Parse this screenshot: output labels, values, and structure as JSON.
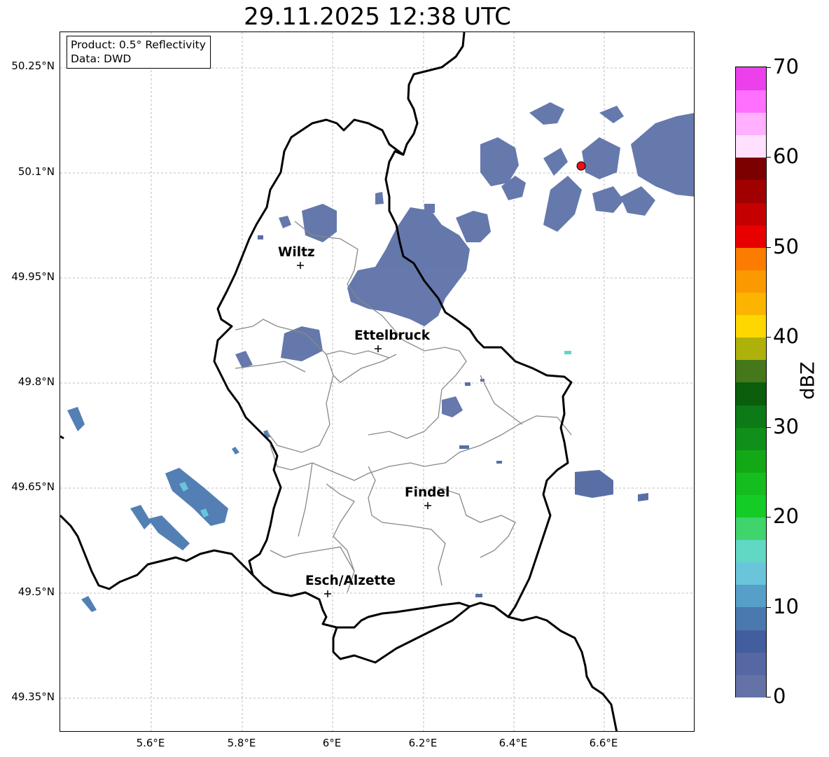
{
  "title": "29.11.2025 12:38 UTC",
  "info": {
    "product": "Product: 0.5° Reflectivity",
    "data_source": "Data: DWD"
  },
  "lat_ticks": [
    "50.25°N",
    "50.1°N",
    "49.95°N",
    "49.8°N",
    "49.65°N",
    "49.5°N",
    "49.35°N"
  ],
  "lon_ticks": [
    "5.6°E",
    "5.8°E",
    "6°E",
    "6.2°E",
    "6.4°E",
    "6.6°E"
  ],
  "cities": [
    {
      "name": "Wiltz"
    },
    {
      "name": "Ettelbruck"
    },
    {
      "name": "Findel"
    },
    {
      "name": "Esch/Alzette"
    }
  ],
  "radar_site_color": "#e8121b",
  "colorbar": {
    "label": "dBZ",
    "ticks": [
      "0",
      "10",
      "20",
      "30",
      "40",
      "50",
      "60",
      "70"
    ],
    "colors": [
      "#6572a8",
      "#5568a3",
      "#435e9f",
      "#4a79b0",
      "#569fc8",
      "#6ac5db",
      "#60d8c4",
      "#3fd46c",
      "#14cc25",
      "#15be1e",
      "#12a816",
      "#10901a",
      "#0c7a16",
      "#0a5e0c",
      "#44781a",
      "#adb10a",
      "#ffd700",
      "#fbb500",
      "#fb9a00",
      "#fb7c00",
      "#e80000",
      "#c40000",
      "#a00000",
      "#7c0000",
      "#ffe0ff",
      "#ffb0ff",
      "#ff70ff",
      "#ec40ec"
    ]
  }
}
